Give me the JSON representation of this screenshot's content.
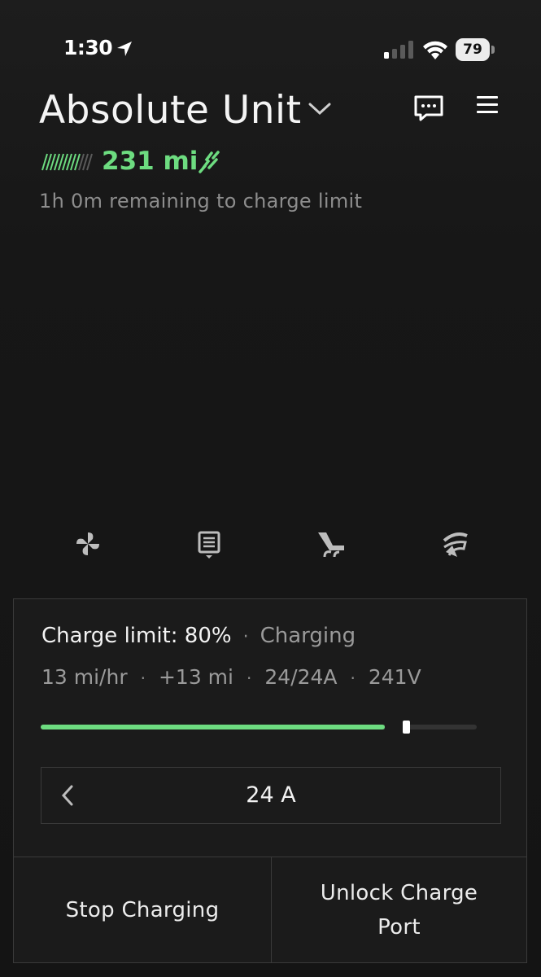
{
  "status_bar": {
    "time": "1:30",
    "battery_level": "79",
    "icons": [
      "location-arrow-icon",
      "cellular-signal-icon",
      "wifi-icon",
      "battery-icon"
    ]
  },
  "vehicle": {
    "name": "Absolute Unit",
    "range": "231 mi",
    "remaining": "1h 0m remaining to charge limit"
  },
  "header_icons": [
    "chevron-down-icon",
    "chat-icon",
    "menu-icon",
    "charging-plug-icon"
  ],
  "controls": [
    {
      "name": "fan-icon"
    },
    {
      "name": "defrost-icon"
    },
    {
      "name": "seat-heater-icon"
    },
    {
      "name": "steering-wheel-heater-icon"
    }
  ],
  "charge": {
    "limit_label": "Charge limit: 80%",
    "status": "Charging",
    "separator": "·",
    "rate": "13 mi/hr",
    "added": "+13 mi",
    "current": "24/24A",
    "voltage": "241V",
    "current_battery_fraction": 0.79,
    "limit_fraction": 0.8,
    "amp_setting": "24 A"
  },
  "buttons": {
    "stop": "Stop Charging",
    "unlock_line1": "Unlock Charge",
    "unlock_line2": "Port"
  },
  "colors": {
    "accent_green": "#6ddc80",
    "background": "#151515",
    "card_border": "#3a3a3a"
  }
}
